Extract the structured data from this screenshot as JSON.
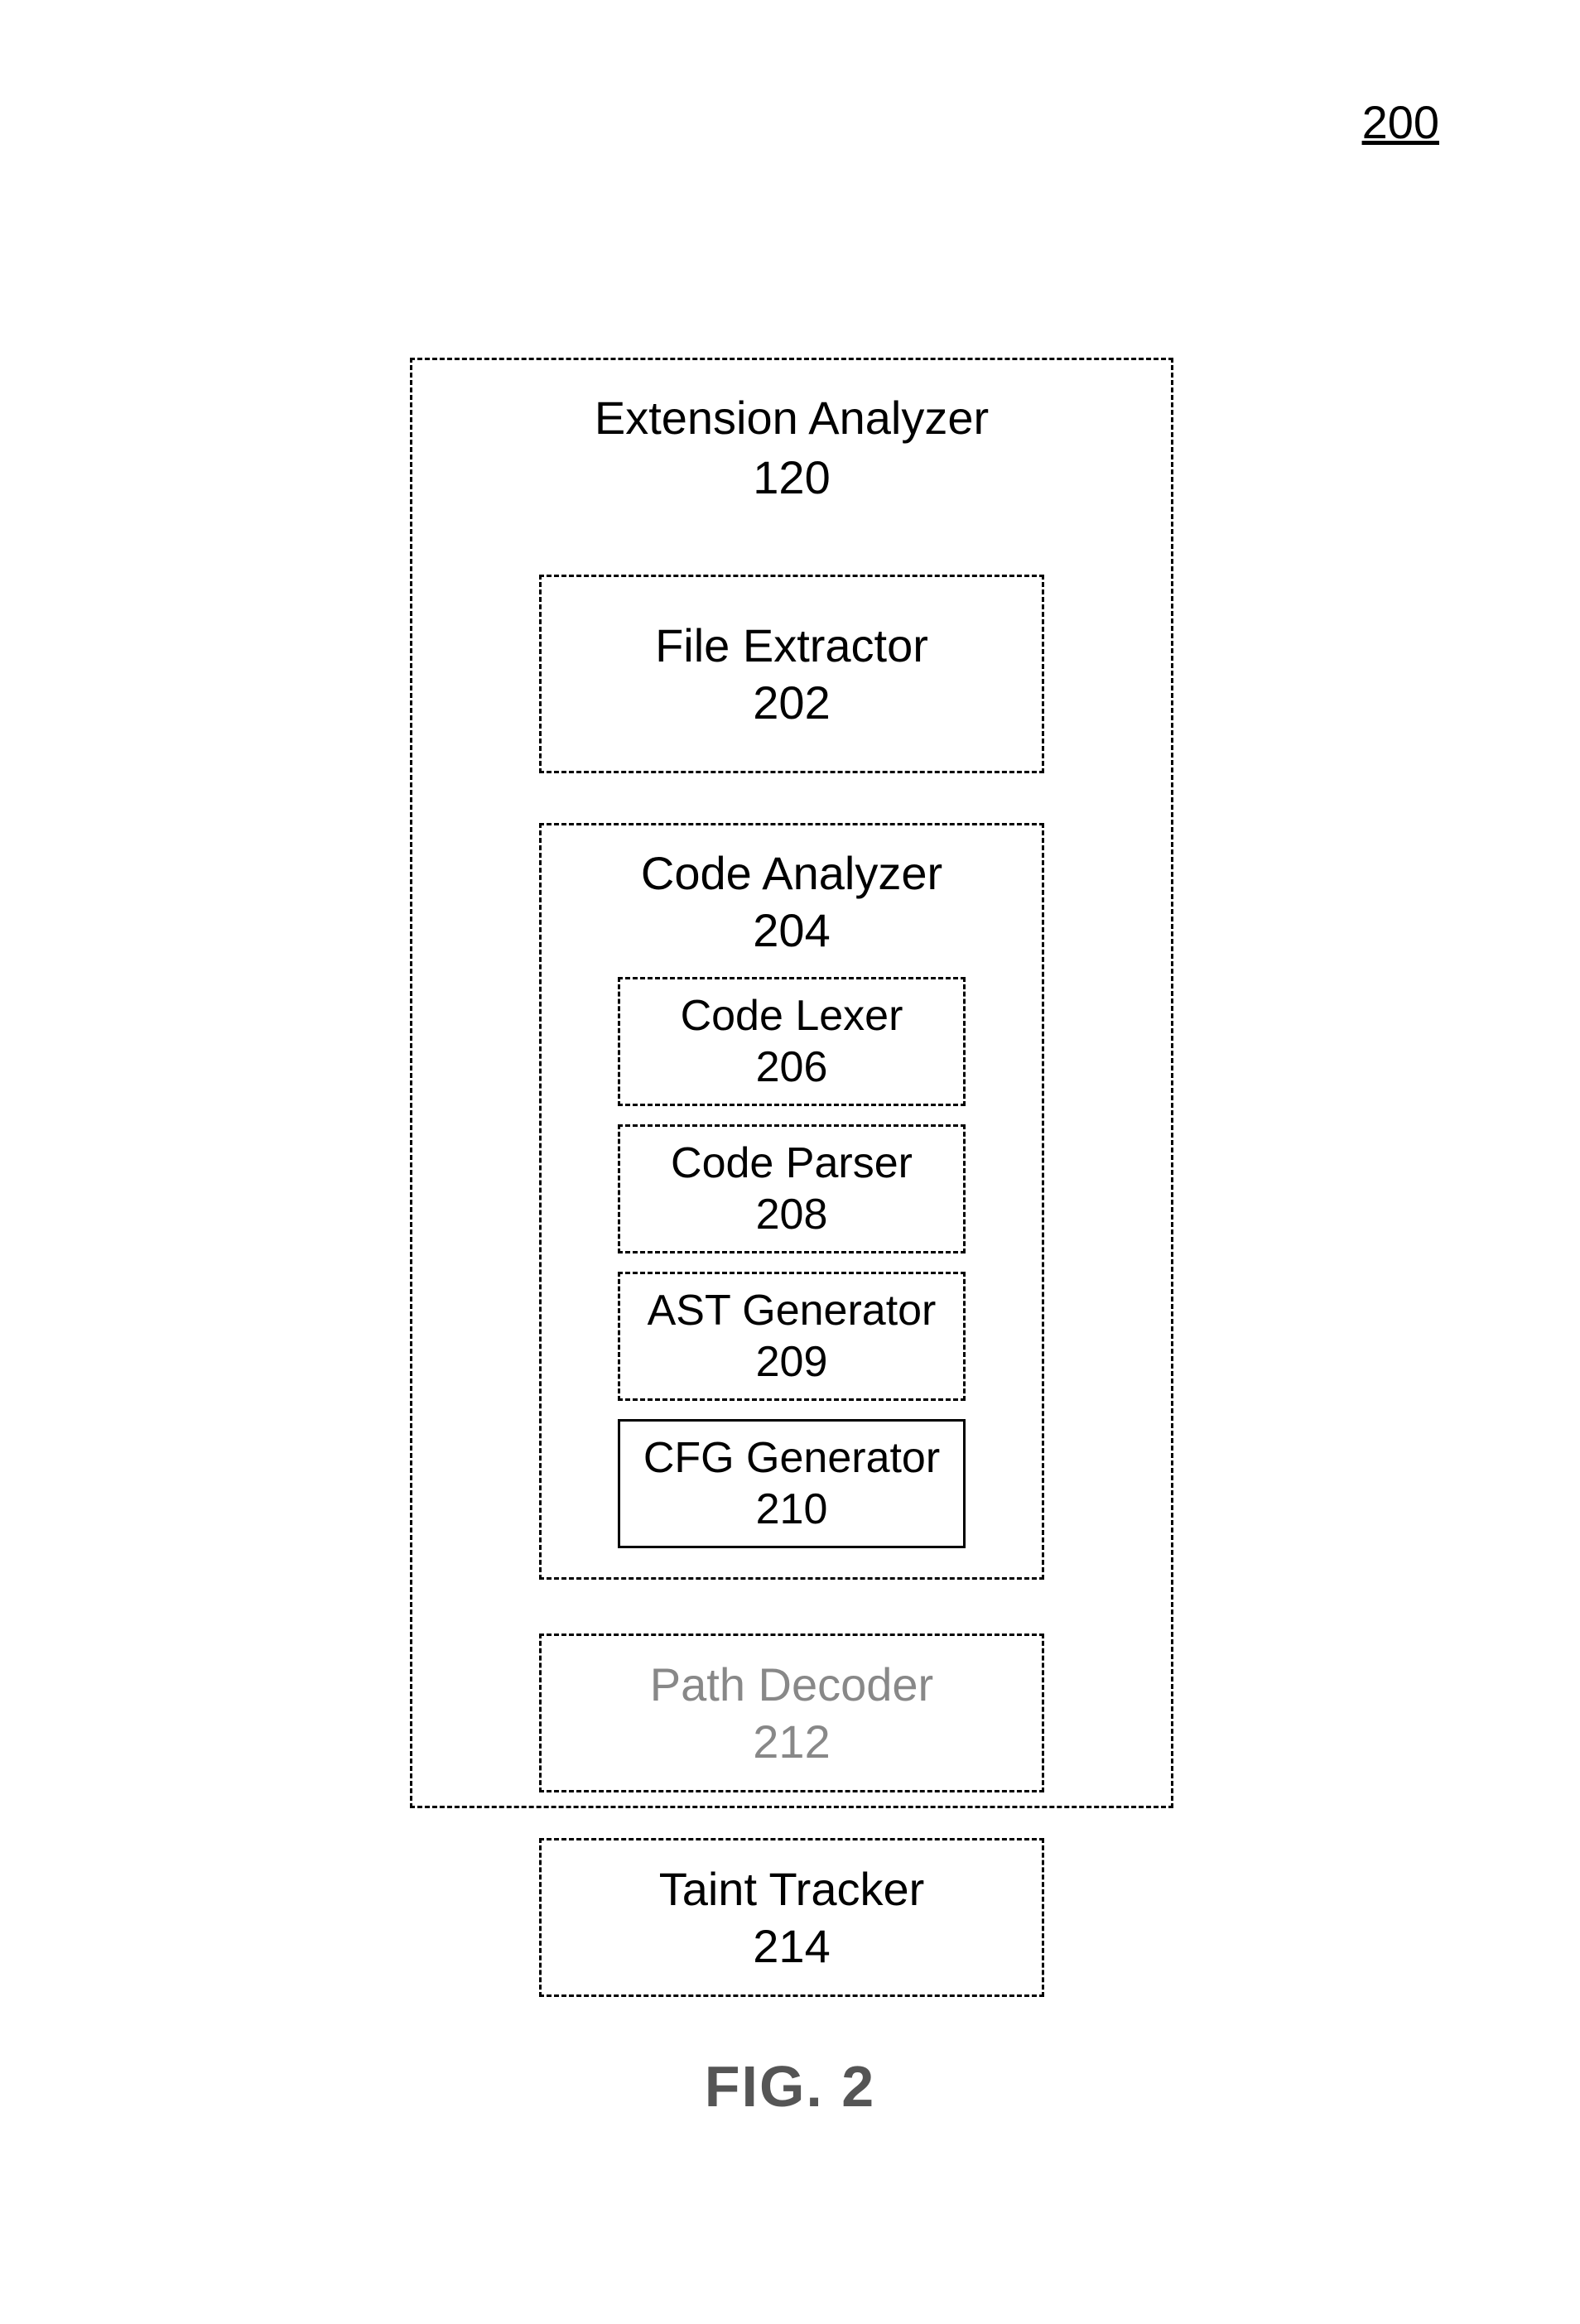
{
  "page_number": "200",
  "figure_caption": "FIG. 2",
  "outer": {
    "title": "Extension Analyzer",
    "num": "120"
  },
  "file_extractor": {
    "title": "File Extractor",
    "num": "202"
  },
  "code_analyzer": {
    "title": "Code Analyzer",
    "num": "204",
    "code_lexer": {
      "title": "Code Lexer",
      "num": "206"
    },
    "code_parser": {
      "title": "Code Parser",
      "num": "208"
    },
    "ast_generator": {
      "title": "AST Generator",
      "num": "209"
    },
    "cfg_generator": {
      "title": "CFG Generator",
      "num": "210"
    }
  },
  "path_decoder": {
    "title": "Path Decoder",
    "num": "212"
  },
  "taint_tracker": {
    "title": "Taint Tracker",
    "num": "214"
  }
}
